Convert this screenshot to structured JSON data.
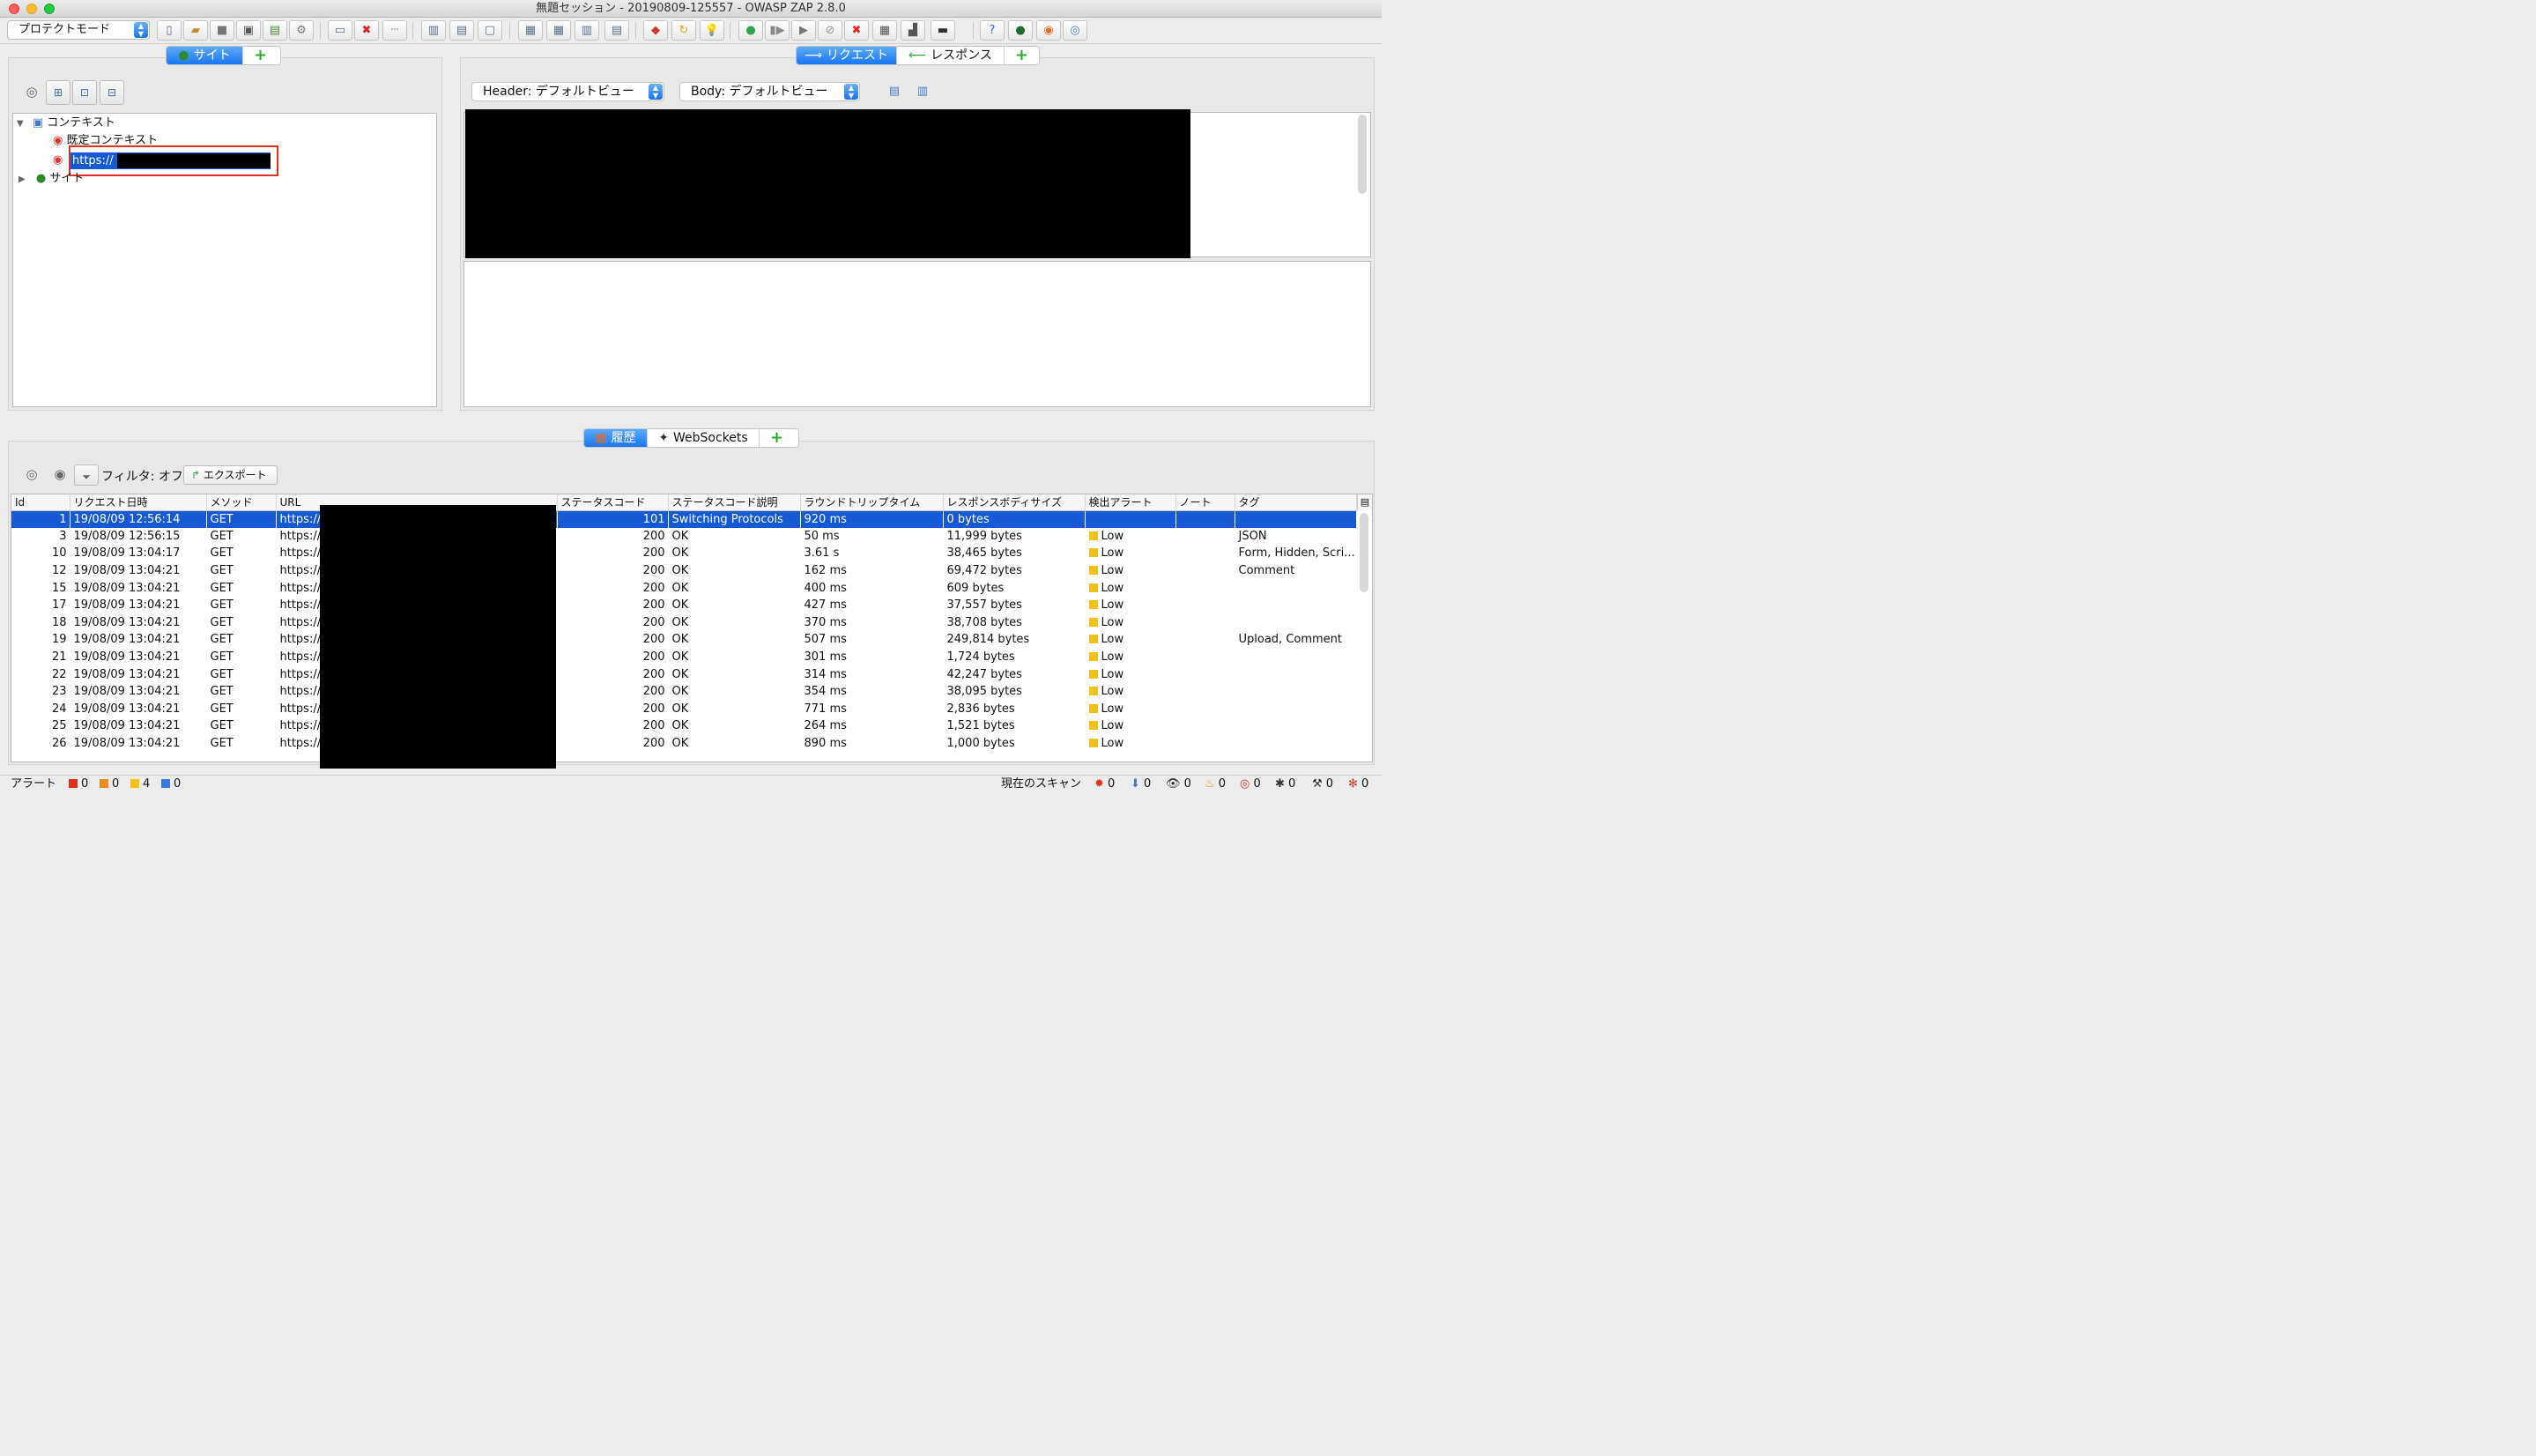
{
  "window": {
    "title": "無題セッション - 20190809-125557 - OWASP ZAP 2.8.0"
  },
  "toolbar": {
    "mode": "プロテクトモード"
  },
  "sites_panel": {
    "tabs": {
      "sites": "サイト",
      "add": "+"
    },
    "tree": {
      "contexts": "コンテキスト",
      "default_context": "既定コンテキスト",
      "new_context_value": "https://",
      "sites": "サイト"
    }
  },
  "request_panel": {
    "tabs": {
      "request": "リクエスト",
      "response": "レスポンス",
      "add": "+"
    },
    "header_view": "Header: デフォルトビュー",
    "body_view": "Body: デフォルトビュー"
  },
  "history_panel": {
    "tabs": {
      "history": "履歴",
      "websockets": "WebSockets",
      "add": "+"
    },
    "filter_label": "フィルタ: オフ",
    "export_label": "エクスポート",
    "columns": [
      "Id",
      "リクエスト日時",
      "メソッド",
      "URL",
      "ステータスコード",
      "ステータスコード説明",
      "ラウンドトリップタイム",
      "レスポンスボディサイズ",
      "検出アラート",
      "ノート",
      "タグ"
    ],
    "rows": [
      {
        "id": "1",
        "date": "19/08/09 12:56:14",
        "method": "GET",
        "url": "https://",
        "code": "101",
        "reason": "Switching Protocols",
        "rtt": "920 ms",
        "size": "0 bytes",
        "alert": "",
        "note": "",
        "tags": ""
      },
      {
        "id": "3",
        "date": "19/08/09 12:56:15",
        "method": "GET",
        "url": "https://",
        "code": "200",
        "reason": "OK",
        "rtt": "50 ms",
        "size": "11,999 bytes",
        "alert": "Low",
        "note": "",
        "tags": "JSON"
      },
      {
        "id": "10",
        "date": "19/08/09 13:04:17",
        "method": "GET",
        "url": "https://",
        "code": "200",
        "reason": "OK",
        "rtt": "3.61 s",
        "size": "38,465 bytes",
        "alert": "Low",
        "note": "",
        "tags": "Form, Hidden, Scri..."
      },
      {
        "id": "12",
        "date": "19/08/09 13:04:21",
        "method": "GET",
        "url": "https://",
        "code": "200",
        "reason": "OK",
        "rtt": "162 ms",
        "size": "69,472 bytes",
        "alert": "Low",
        "note": "",
        "tags": "Comment"
      },
      {
        "id": "15",
        "date": "19/08/09 13:04:21",
        "method": "GET",
        "url": "https://",
        "code": "200",
        "reason": "OK",
        "rtt": "400 ms",
        "size": "609 bytes",
        "alert": "Low",
        "note": "",
        "tags": ""
      },
      {
        "id": "17",
        "date": "19/08/09 13:04:21",
        "method": "GET",
        "url": "https://",
        "code": "200",
        "reason": "OK",
        "rtt": "427 ms",
        "size": "37,557 bytes",
        "alert": "Low",
        "note": "",
        "tags": ""
      },
      {
        "id": "18",
        "date": "19/08/09 13:04:21",
        "method": "GET",
        "url": "https://",
        "code": "200",
        "reason": "OK",
        "rtt": "370 ms",
        "size": "38,708 bytes",
        "alert": "Low",
        "note": "",
        "tags": ""
      },
      {
        "id": "19",
        "date": "19/08/09 13:04:21",
        "method": "GET",
        "url": "https://",
        "code": "200",
        "reason": "OK",
        "rtt": "507 ms",
        "size": "249,814 bytes",
        "alert": "Low",
        "note": "",
        "tags": "Upload, Comment"
      },
      {
        "id": "21",
        "date": "19/08/09 13:04:21",
        "method": "GET",
        "url": "https://",
        "code": "200",
        "reason": "OK",
        "rtt": "301 ms",
        "size": "1,724 bytes",
        "alert": "Low",
        "note": "",
        "tags": ""
      },
      {
        "id": "22",
        "date": "19/08/09 13:04:21",
        "method": "GET",
        "url": "https://",
        "code": "200",
        "reason": "OK",
        "rtt": "314 ms",
        "size": "42,247 bytes",
        "alert": "Low",
        "note": "",
        "tags": ""
      },
      {
        "id": "23",
        "date": "19/08/09 13:04:21",
        "method": "GET",
        "url": "https://",
        "code": "200",
        "reason": "OK",
        "rtt": "354 ms",
        "size": "38,095 bytes",
        "alert": "Low",
        "note": "",
        "tags": ""
      },
      {
        "id": "24",
        "date": "19/08/09 13:04:21",
        "method": "GET",
        "url": "https://",
        "code": "200",
        "reason": "OK",
        "rtt": "771 ms",
        "size": "2,836 bytes",
        "alert": "Low",
        "note": "",
        "tags": ""
      },
      {
        "id": "25",
        "date": "19/08/09 13:04:21",
        "method": "GET",
        "url": "https://",
        "code": "200",
        "reason": "OK",
        "rtt": "264 ms",
        "size": "1,521 bytes",
        "alert": "Low",
        "note": "",
        "tags": ""
      },
      {
        "id": "26",
        "date": "19/08/09 13:04:21",
        "method": "GET",
        "url": "https://",
        "code": "200",
        "reason": "OK",
        "rtt": "890 ms",
        "size": "1,000 bytes",
        "alert": "Low",
        "note": "",
        "tags": ""
      }
    ]
  },
  "statusbar": {
    "alerts_label": "アラート",
    "alert_high": "0",
    "alert_medium": "0",
    "alert_low": "4",
    "alert_info": "0",
    "current_scans_label": "現在のスキャン",
    "scan_counts": [
      "0",
      "0",
      "0",
      "0",
      "0",
      "0",
      "0",
      "0"
    ]
  },
  "colors": {
    "selection": "#1559d4",
    "tab_active": "#1b77ef",
    "highlight_box": "#e0301e"
  }
}
